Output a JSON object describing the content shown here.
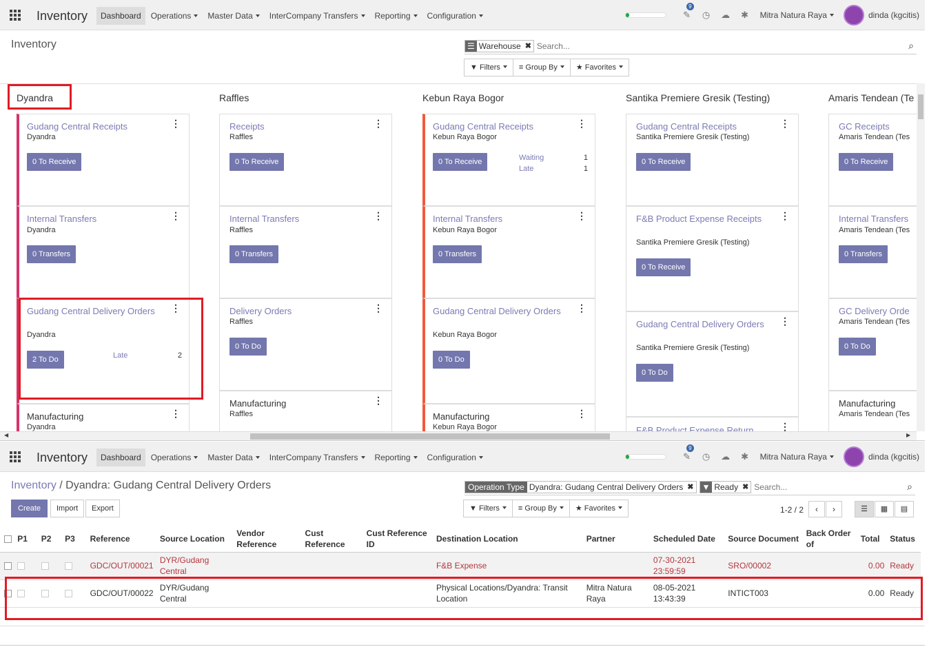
{
  "navbar": {
    "app_title": "Inventory",
    "menu": [
      "Dashboard",
      "Operations",
      "Master Data",
      "InterCompany Transfers",
      "Reporting",
      "Configuration"
    ],
    "progress_fraction": 0.1,
    "chat_badge": "9",
    "company": "Mitra Natura Raya",
    "user": "dinda (kgcitis)",
    "accent_color": "#7377ad",
    "highlight_color": "#e01b24"
  },
  "dashboard": {
    "title": "Inventory",
    "facet_warehouse": "Warehouse",
    "search_placeholder": "Search...",
    "filters": "Filters",
    "group_by": "Group By",
    "favorites": "Favorites",
    "columns": [
      {
        "name": "Dyandra",
        "cards": [
          {
            "title": "Gudang Central Receipts",
            "sub": "Dyandra",
            "btn": "0 To Receive"
          },
          {
            "title": "Internal Transfers",
            "sub": "Dyandra",
            "btn": "0 Transfers"
          },
          {
            "title": "Gudang Central Delivery Orders",
            "sub": "Dyandra",
            "btn": "2 To Do",
            "stat_label": "Late",
            "stat_val": "2"
          },
          {
            "title": "Manufacturing",
            "sub": "Dyandra"
          }
        ]
      },
      {
        "name": "Raffles",
        "cards": [
          {
            "title": "Receipts",
            "sub": "Raffles",
            "btn": "0 To Receive"
          },
          {
            "title": "Internal Transfers",
            "sub": "Raffles",
            "btn": "0 Transfers"
          },
          {
            "title": "Delivery Orders",
            "sub": "Raffles",
            "btn": "0 To Do"
          },
          {
            "title": "Manufacturing",
            "sub": "Raffles"
          }
        ]
      },
      {
        "name": "Kebun Raya Bogor",
        "cards": [
          {
            "title": "Gudang Central Receipts",
            "sub": "Kebun Raya Bogor",
            "btn": "0 To Receive",
            "stat_label": "Waiting",
            "stat_val": "1",
            "stat_label2": "Late",
            "stat_val2": "1"
          },
          {
            "title": "Internal Transfers",
            "sub": "Kebun Raya Bogor",
            "btn": "0 Transfers"
          },
          {
            "title": "Gudang Central Delivery Orders",
            "sub": "Kebun Raya Bogor",
            "btn": "0 To Do"
          },
          {
            "title": "Manufacturing",
            "sub": "Kebun Raya Bogor"
          }
        ]
      },
      {
        "name": "Santika Premiere Gresik (Testing)",
        "cards": [
          {
            "title": "Gudang Central Receipts",
            "sub": "Santika Premiere Gresik (Testing)",
            "btn": "0 To Receive"
          },
          {
            "title": "F&B Product Expense Receipts",
            "sub": "Santika Premiere Gresik (Testing)",
            "btn": "0 To Receive"
          },
          {
            "title": "Gudang Central Delivery Orders",
            "sub": "Santika Premiere Gresik (Testing)",
            "btn": "0 To Do"
          },
          {
            "title": "F&B Product Expense Return"
          }
        ]
      },
      {
        "name": "Amaris Tendean (Te",
        "cards": [
          {
            "title": "GC Receipts",
            "sub": "Amaris Tendean (Tes",
            "btn": "0 To Receive"
          },
          {
            "title": "Internal Transfers",
            "sub": "Amaris Tendean (Tes",
            "btn": "0 Transfers"
          },
          {
            "title": "GC Delivery Orde",
            "sub": "Amaris Tendean (Tes",
            "btn": "0 To Do"
          },
          {
            "title": "Manufacturing",
            "sub": "Amaris Tendean (Tes"
          }
        ]
      }
    ]
  },
  "list_view": {
    "breadcrumb_root": "Inventory",
    "breadcrumb_sep": "/",
    "breadcrumb_current": "Dyandra: Gudang Central Delivery Orders",
    "facet1_label": "Operation Type",
    "facet1_value": "Dyandra: Gudang Central Delivery Orders",
    "facet2_value": "Ready",
    "search_placeholder": "Search...",
    "create": "Create",
    "import": "Import",
    "export": "Export",
    "filters": "Filters",
    "group_by": "Group By",
    "favorites": "Favorites",
    "pager": "1-2 / 2",
    "headers": [
      "P1",
      "P2",
      "P3",
      "Reference",
      "Source Location",
      "Vendor Reference",
      "Cust Reference",
      "Cust Reference ID",
      "Destination Location",
      "Partner",
      "Scheduled Date",
      "Source Document",
      "Back Order of",
      "Total",
      "Status"
    ],
    "rows": [
      {
        "reference": "GDC/OUT/00021",
        "source": "DYR/Gudang Central",
        "destination": "F&B Expense",
        "partner": "",
        "scheduled": "07-30-2021 23:59:59",
        "source_doc": "SRO/00002",
        "total": "0.00",
        "status": "Ready"
      },
      {
        "reference": "GDC/OUT/00022",
        "source": "DYR/Gudang Central",
        "destination": "Physical Locations/Dyandra: Transit Location",
        "partner": "Mitra Natura Raya",
        "scheduled": "08-05-2021 13:43:39",
        "source_doc": "INTICT003",
        "total": "0.00",
        "status": "Ready"
      }
    ]
  }
}
